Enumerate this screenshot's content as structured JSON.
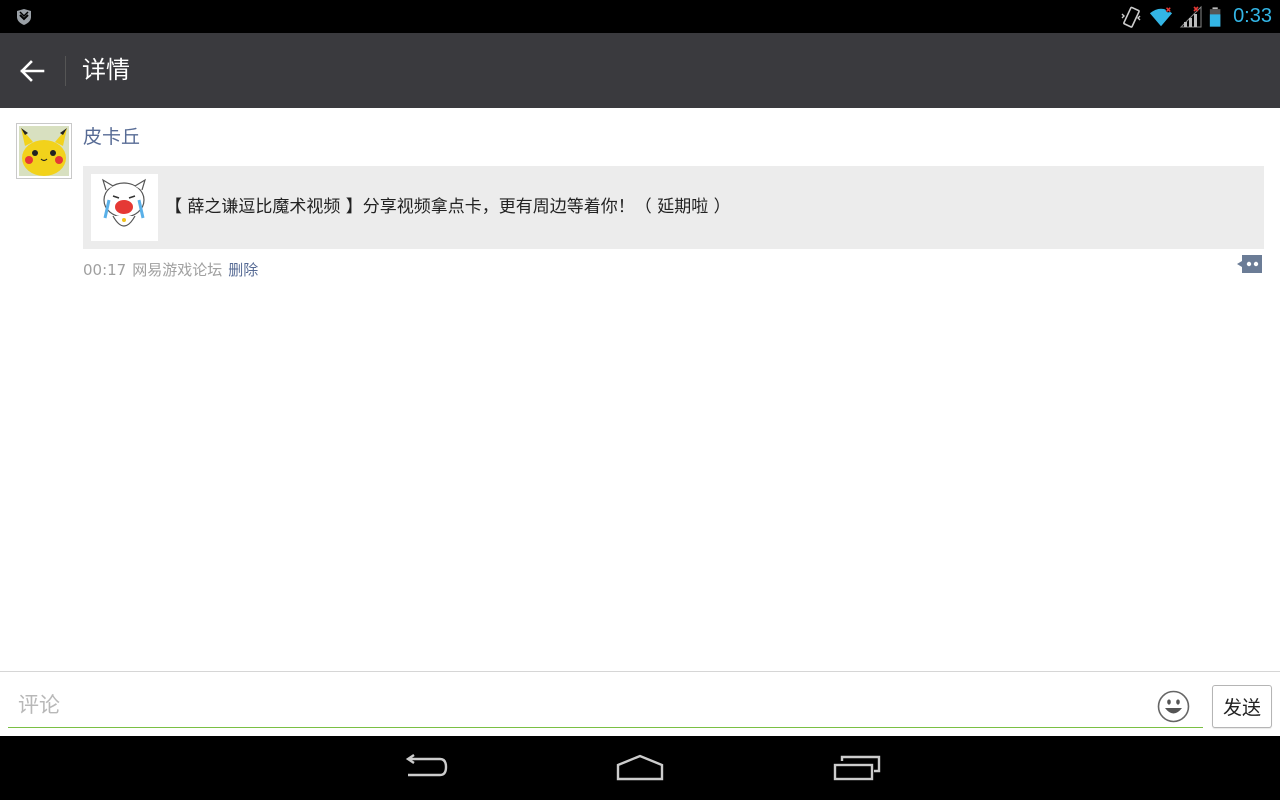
{
  "status_bar": {
    "time": "0:33",
    "icons": [
      "android-notification-icon",
      "vibrate-icon",
      "wifi-icon",
      "signal-icon",
      "battery-icon"
    ]
  },
  "action_bar": {
    "back_icon": "arrow-left-icon",
    "title": "详情"
  },
  "post": {
    "username": "皮卡丘",
    "link_text": "【 薛之谦逗比魔术视频 】分享视频拿点卡，更有周边等着你！（ 延期啦 ）",
    "time": "00:17",
    "source": "网易游戏论坛",
    "delete_label": "删除"
  },
  "comment_bar": {
    "placeholder": "评论",
    "value": "",
    "send_label": "发送"
  },
  "colors": {
    "accent_link": "#576b95",
    "input_underline": "#7ac043",
    "clock": "#33b5e5",
    "action_bar_bg": "#3a3a3e"
  }
}
